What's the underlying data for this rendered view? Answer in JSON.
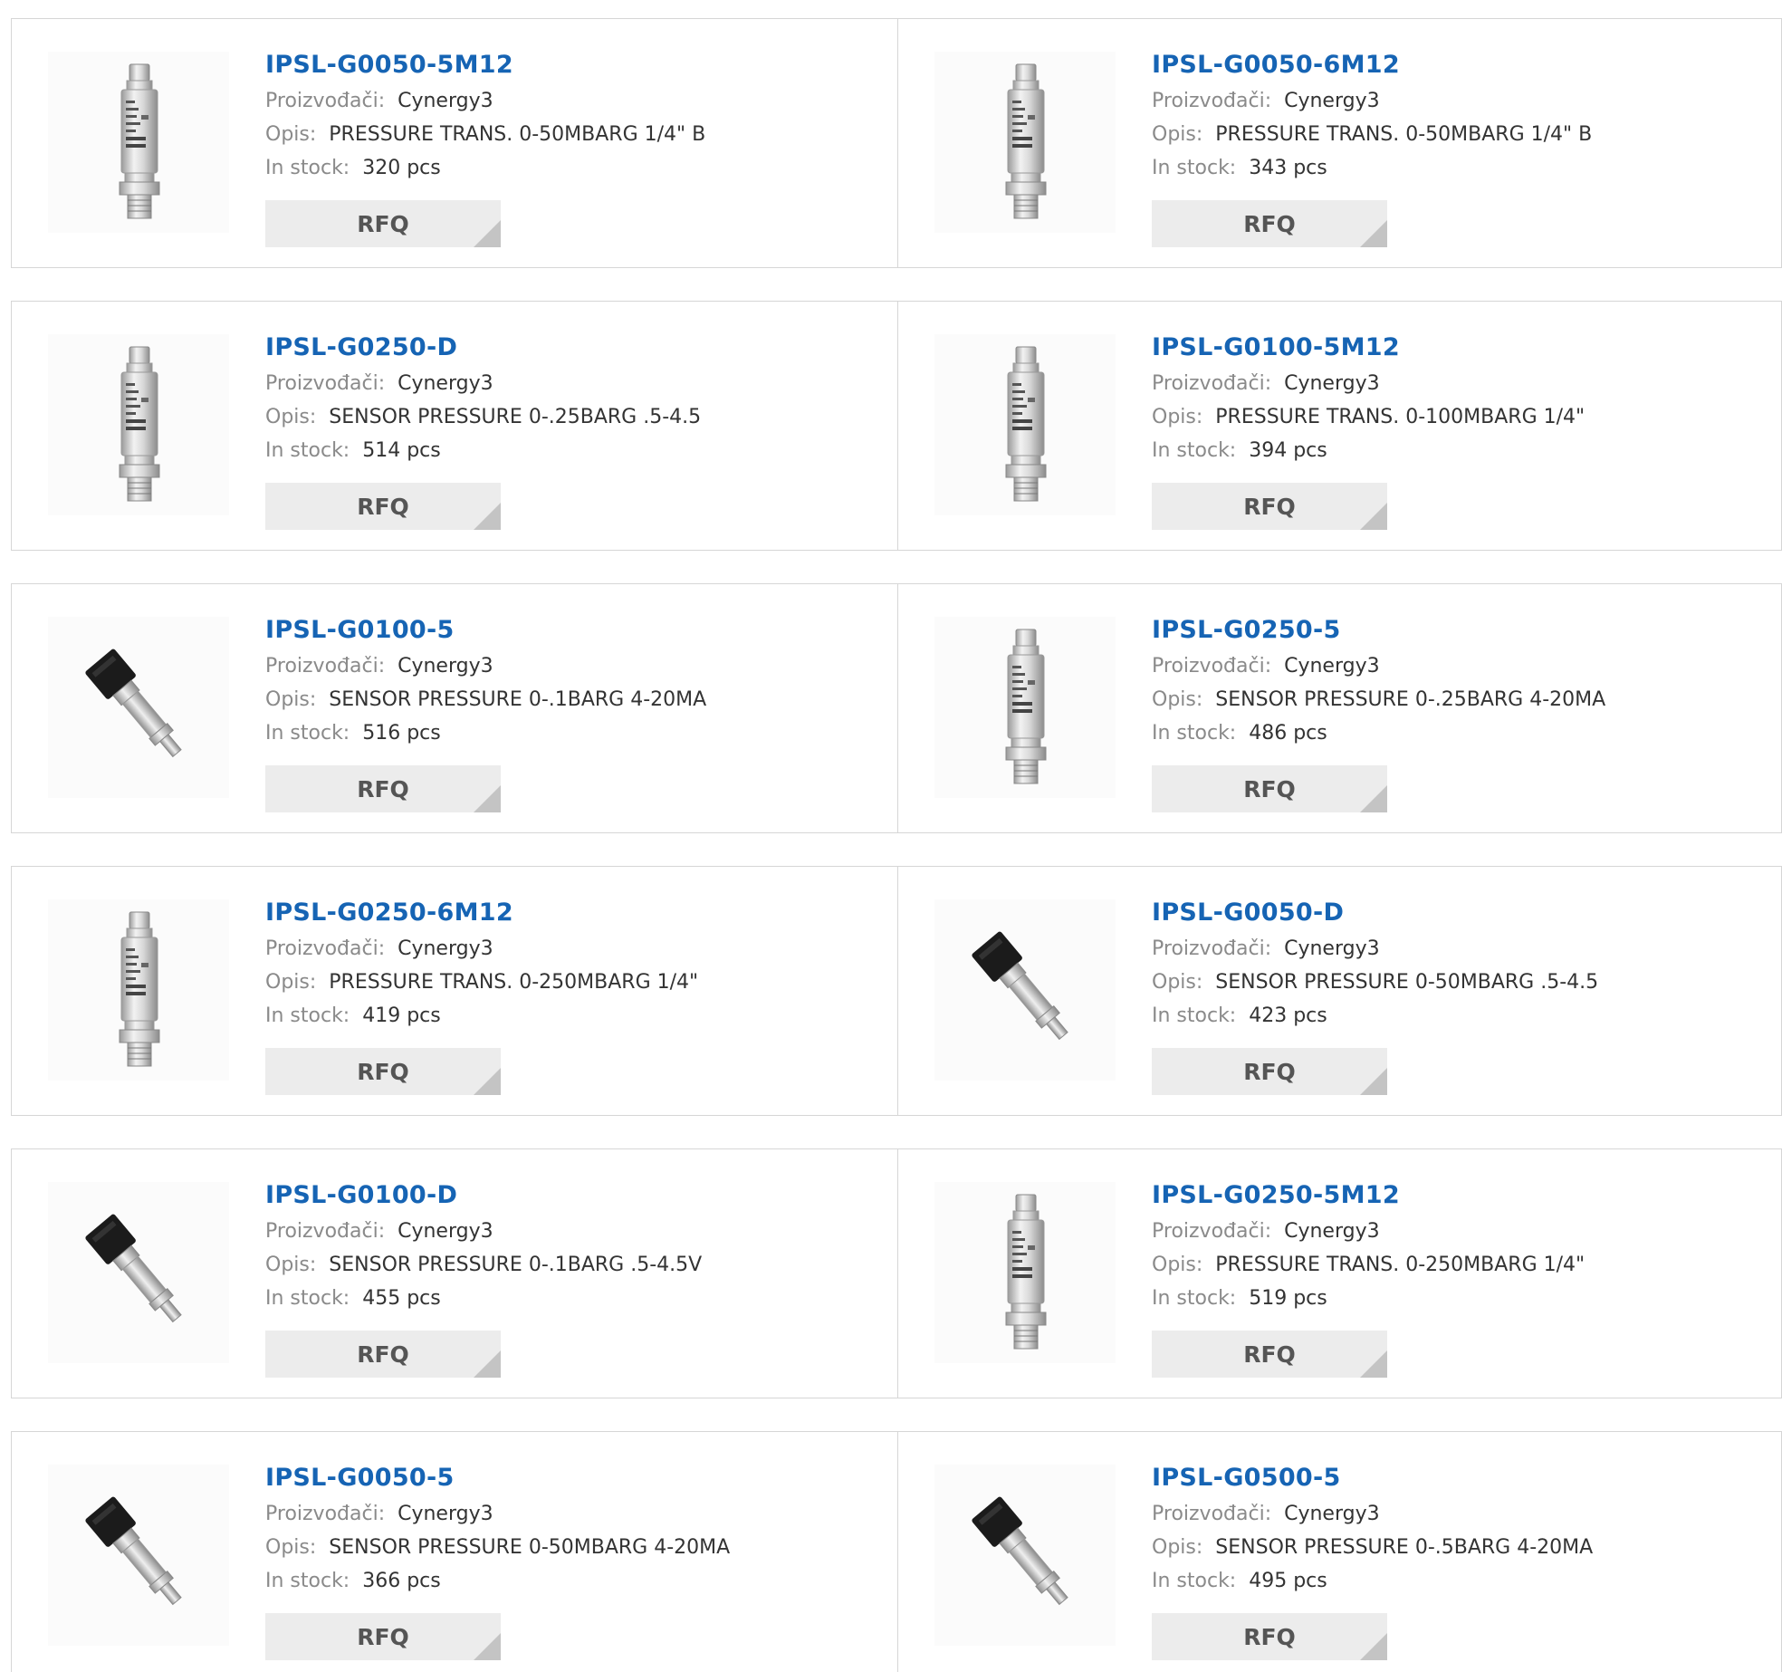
{
  "labels": {
    "manufacturer": "Proizvođači:",
    "description": "Opis:",
    "stock": "In stock:",
    "rfq": "RFQ"
  },
  "products": [
    {
      "part": "IPSL-G0050-5M12",
      "manufacturer": "Cynergy3",
      "description": "PRESSURE TRANS. 0-50MBARG 1/4\" B",
      "stock": "320 pcs",
      "image": "inline-pressure-sensor"
    },
    {
      "part": "IPSL-G0050-6M12",
      "manufacturer": "Cynergy3",
      "description": "PRESSURE TRANS. 0-50MBARG 1/4\" B",
      "stock": "343 pcs",
      "image": "inline-pressure-sensor"
    },
    {
      "part": "IPSL-G0250-D",
      "manufacturer": "Cynergy3",
      "description": "SENSOR PRESSURE 0-.25BARG .5-4.5",
      "stock": "514 pcs",
      "image": "inline-pressure-sensor"
    },
    {
      "part": "IPSL-G0100-5M12",
      "manufacturer": "Cynergy3",
      "description": "PRESSURE TRANS. 0-100MBARG 1/4\"",
      "stock": "394 pcs",
      "image": "inline-pressure-sensor"
    },
    {
      "part": "IPSL-G0100-5",
      "manufacturer": "Cynergy3",
      "description": "SENSOR PRESSURE 0-.1BARG 4-20MA",
      "stock": "516 pcs",
      "image": "angled-pressure-sensor"
    },
    {
      "part": "IPSL-G0250-5",
      "manufacturer": "Cynergy3",
      "description": "SENSOR PRESSURE 0-.25BARG 4-20MA",
      "stock": "486 pcs",
      "image": "inline-pressure-sensor"
    },
    {
      "part": "IPSL-G0250-6M12",
      "manufacturer": "Cynergy3",
      "description": "PRESSURE TRANS. 0-250MBARG 1/4\"",
      "stock": "419 pcs",
      "image": "inline-pressure-sensor"
    },
    {
      "part": "IPSL-G0050-D",
      "manufacturer": "Cynergy3",
      "description": "SENSOR PRESSURE 0-50MBARG .5-4.5",
      "stock": "423 pcs",
      "image": "angled-pressure-sensor"
    },
    {
      "part": "IPSL-G0100-D",
      "manufacturer": "Cynergy3",
      "description": "SENSOR PRESSURE 0-.1BARG .5-4.5V",
      "stock": "455 pcs",
      "image": "angled-pressure-sensor"
    },
    {
      "part": "IPSL-G0250-5M12",
      "manufacturer": "Cynergy3",
      "description": "PRESSURE TRANS. 0-250MBARG 1/4\"",
      "stock": "519 pcs",
      "image": "inline-pressure-sensor"
    },
    {
      "part": "IPSL-G0050-5",
      "manufacturer": "Cynergy3",
      "description": "SENSOR PRESSURE 0-50MBARG 4-20MA",
      "stock": "366 pcs",
      "image": "angled-pressure-sensor"
    },
    {
      "part": "IPSL-G0500-5",
      "manufacturer": "Cynergy3",
      "description": "SENSOR PRESSURE 0-.5BARG 4-20MA",
      "stock": "495 pcs",
      "image": "angled-pressure-sensor"
    }
  ],
  "colors": {
    "part_link": "#1664b4",
    "border": "#d6d6d6",
    "label": "#8a8a8a",
    "rfq_bg": "#ececec"
  }
}
